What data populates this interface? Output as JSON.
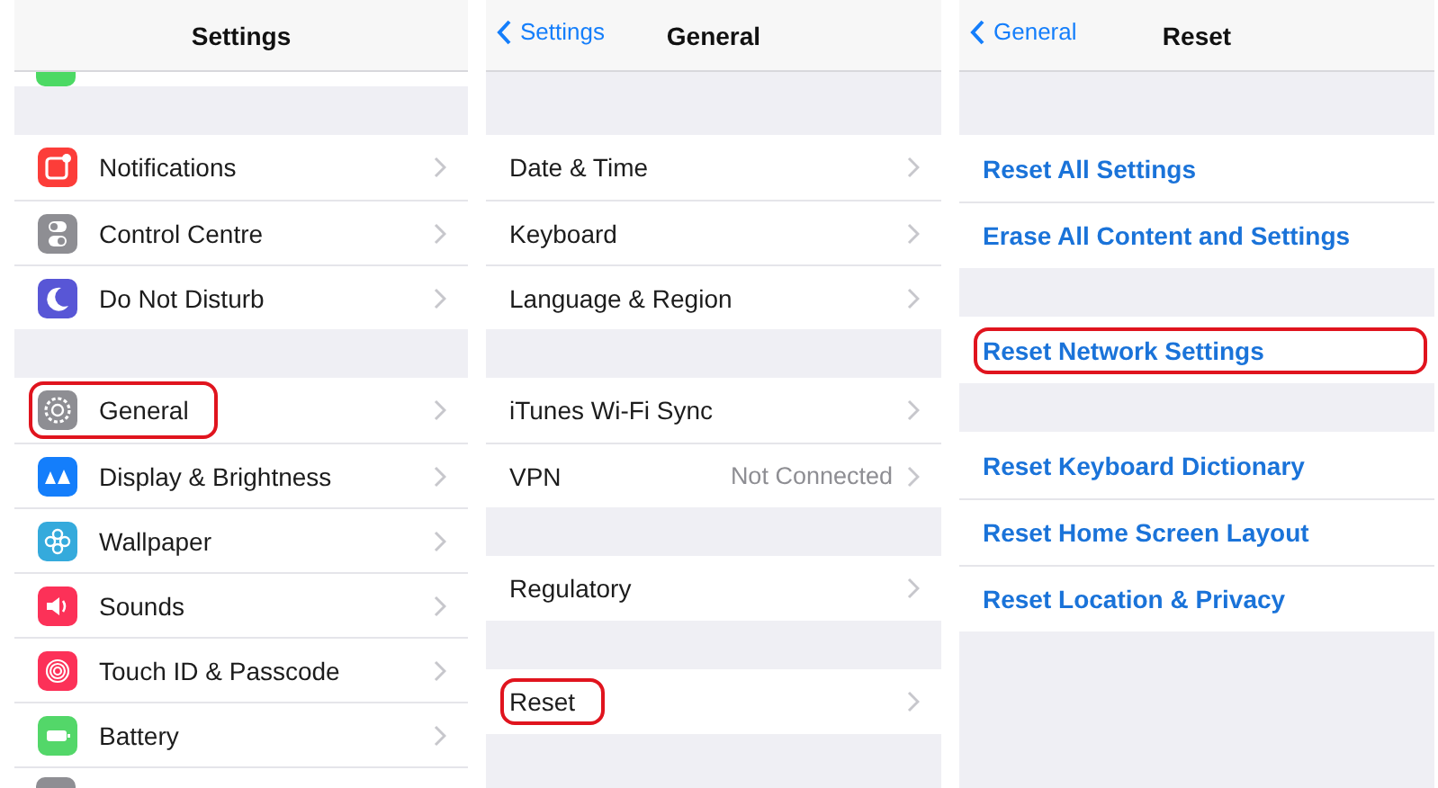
{
  "panels": [
    {
      "nav": {
        "title": "Settings"
      },
      "groups": [
        {
          "rows": [
            {
              "kind": "clipped",
              "color": "#4cd964"
            }
          ]
        },
        {
          "rows": [
            {
              "kind": "nav",
              "label": "Notifications",
              "color": "#fc3d39",
              "highlighted": false
            },
            {
              "kind": "nav",
              "label": "Control Centre",
              "color": "#8e8e93",
              "highlighted": false
            },
            {
              "kind": "nav",
              "label": "Do Not Disturb",
              "color": "#5856d6",
              "highlighted": false
            }
          ]
        },
        {
          "rows": [
            {
              "kind": "nav",
              "label": "General",
              "color": "#8e8e93",
              "highlighted": true
            },
            {
              "kind": "nav",
              "label": "Display & Brightness",
              "color": "#147efb",
              "highlighted": false
            },
            {
              "kind": "nav",
              "label": "Wallpaper",
              "color": "#35aadc",
              "highlighted": false
            },
            {
              "kind": "nav",
              "label": "Sounds",
              "color": "#fc3158",
              "highlighted": false
            },
            {
              "kind": "nav",
              "label": "Touch ID & Passcode",
              "color": "#fc3158",
              "highlighted": false
            },
            {
              "kind": "nav",
              "label": "Battery",
              "color": "#53d769",
              "highlighted": false
            },
            {
              "kind": "clipped",
              "color": "#8e8e93"
            }
          ]
        }
      ]
    },
    {
      "nav": {
        "title": "General",
        "back": "Settings"
      },
      "groups": [
        {
          "rows": [
            {
              "kind": "nav",
              "label": "Date & Time",
              "highlighted": false
            },
            {
              "kind": "nav",
              "label": "Keyboard",
              "highlighted": false
            },
            {
              "kind": "nav",
              "label": "Language & Region",
              "highlighted": false
            }
          ]
        },
        {
          "rows": [
            {
              "kind": "nav",
              "label": "iTunes Wi-Fi Sync",
              "highlighted": false
            },
            {
              "kind": "nav",
              "label": "VPN",
              "value": "Not Connected",
              "highlighted": false
            }
          ]
        },
        {
          "rows": [
            {
              "kind": "nav",
              "label": "Regulatory",
              "highlighted": false
            }
          ]
        },
        {
          "rows": [
            {
              "kind": "nav",
              "label": "Reset",
              "highlighted": true
            }
          ]
        }
      ]
    },
    {
      "nav": {
        "title": "Reset",
        "back": "General"
      },
      "groups": [
        {
          "rows": [
            {
              "kind": "action",
              "label": "Reset All Settings",
              "highlighted": false
            },
            {
              "kind": "action",
              "label": "Erase All Content and Settings",
              "highlighted": false
            }
          ]
        },
        {
          "rows": [
            {
              "kind": "action",
              "label": "Reset Network Settings",
              "highlighted": true
            }
          ]
        },
        {
          "rows": [
            {
              "kind": "action",
              "label": "Reset Keyboard Dictionary",
              "highlighted": false
            },
            {
              "kind": "action",
              "label": "Reset Home Screen Layout",
              "highlighted": false
            },
            {
              "kind": "action",
              "label": "Reset Location & Privacy",
              "highlighted": false
            }
          ]
        }
      ]
    }
  ]
}
